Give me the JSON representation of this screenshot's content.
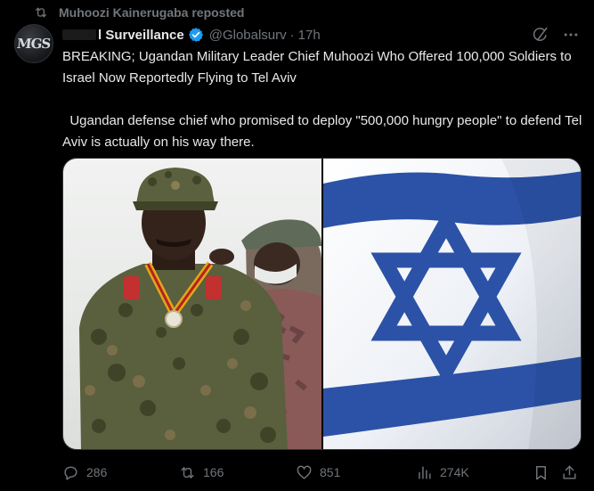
{
  "repost": {
    "icon": "repost-icon",
    "label": "Muhoozi Kainerugaba reposted"
  },
  "author": {
    "avatar_text": "MGS",
    "name": "l Surveillance",
    "verified_icon": "verified-badge-icon",
    "handle": "@Globalsurv",
    "separator": "·",
    "time": "17h"
  },
  "header_actions": [
    "grok-icon",
    "more-icon"
  ],
  "post": {
    "text": "BREAKING; Ugandan Military Leader Chief Muhoozi Who Offered 100,000 Soldiers to Israel Now Reportedly Flying to Tel Aviv\n\n  Ugandan defense chief who promised to deploy \"500,000 hungry people\" to defend Tel Aviv is actually on his way there."
  },
  "media": {
    "left": "photo of military officer in camouflage uniform with medal",
    "right": "Israeli flag with blue Star of David"
  },
  "actions": {
    "replies": "286",
    "reposts": "166",
    "likes": "851",
    "views": "274K"
  },
  "colors": {
    "background": "#000000",
    "text": "#e7e9ea",
    "muted": "#71767b",
    "verified": "#1d9bf0",
    "flag_blue": "#2a52a8"
  }
}
